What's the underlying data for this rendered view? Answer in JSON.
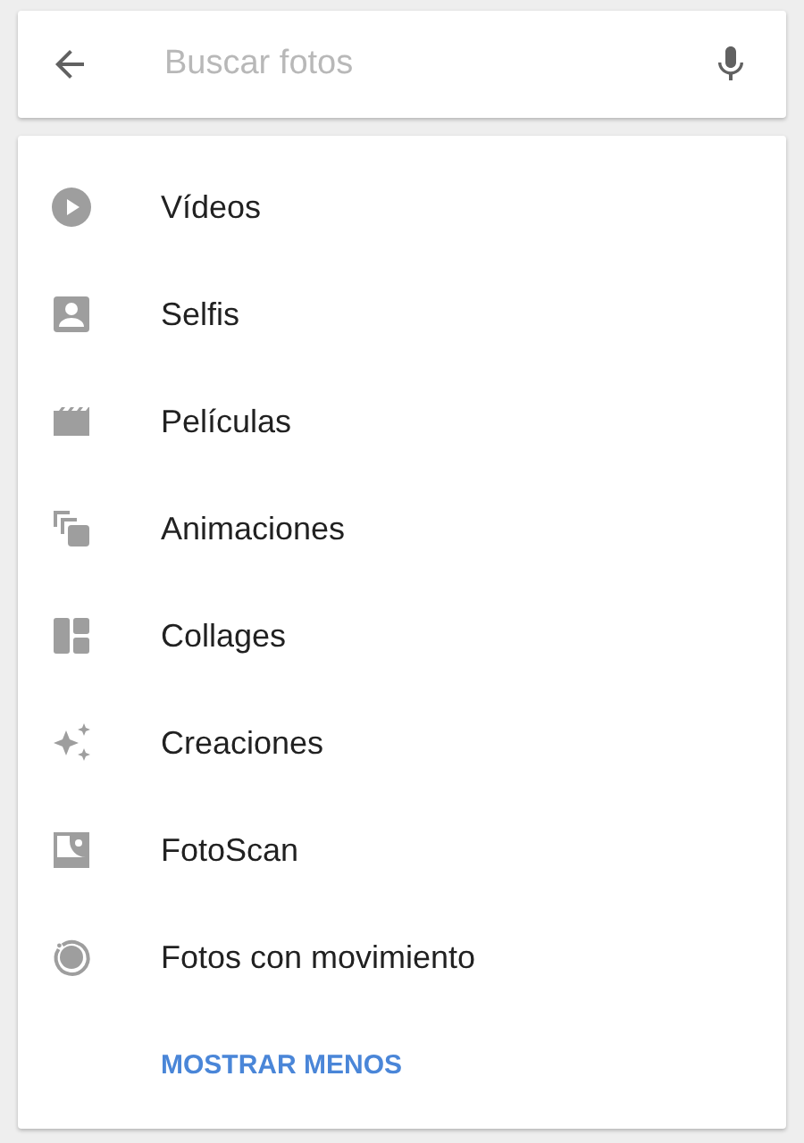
{
  "search": {
    "placeholder": "Buscar fotos"
  },
  "items": [
    {
      "kind": "video",
      "label": "Vídeos"
    },
    {
      "kind": "selfie",
      "label": "Selfis"
    },
    {
      "kind": "movie",
      "label": "Películas"
    },
    {
      "kind": "animation",
      "label": "Animaciones"
    },
    {
      "kind": "collage",
      "label": "Collages"
    },
    {
      "kind": "creation",
      "label": "Creaciones"
    },
    {
      "kind": "photoscan",
      "label": "FotoScan"
    },
    {
      "kind": "motion",
      "label": "Fotos con movimiento"
    }
  ],
  "show_less": "MOSTRAR MENOS"
}
